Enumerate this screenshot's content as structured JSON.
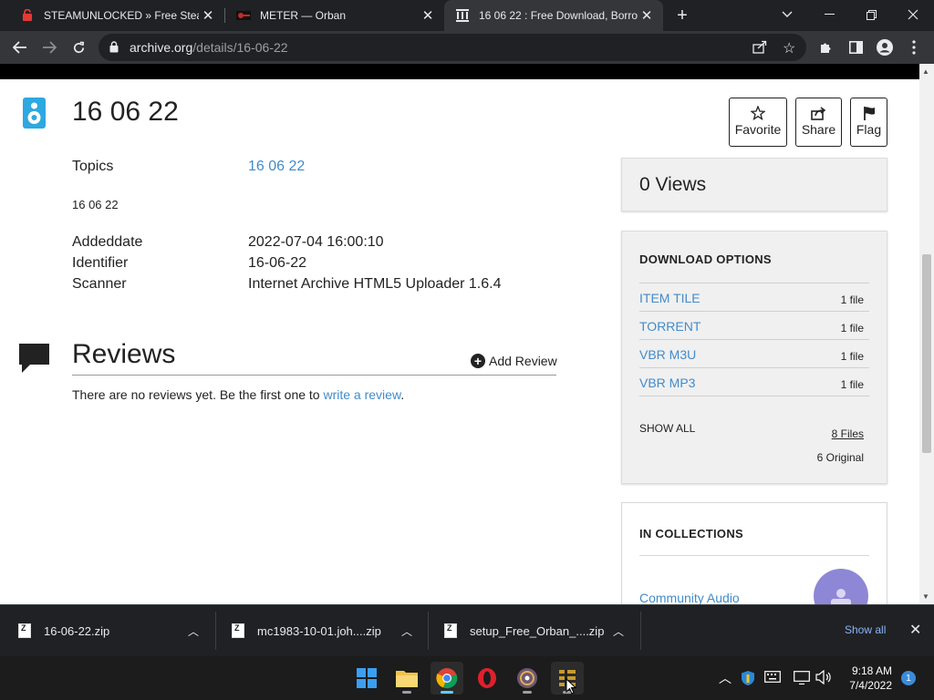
{
  "browser": {
    "tabs": [
      {
        "title": "STEAMUNLOCKED » Free Steam"
      },
      {
        "title": "METER — Orban"
      },
      {
        "title": "16 06 22 : Free Download, Borrow"
      }
    ],
    "url_domain": "archive.org",
    "url_path": "/details/16-06-22"
  },
  "item": {
    "title": "16 06 22",
    "actions": {
      "favorite": "Favorite",
      "share": "Share",
      "flag": "Flag"
    },
    "topics_label": "Topics",
    "topics_value": "16 06 22",
    "description": "16 06 22",
    "metadata": [
      {
        "label": "Addeddate",
        "value": "2022-07-04 16:00:10"
      },
      {
        "label": "Identifier",
        "value": "16-06-22"
      },
      {
        "label": "Scanner",
        "value": "Internet Archive HTML5 Uploader 1.6.4"
      }
    ]
  },
  "reviews": {
    "title": "Reviews",
    "add_label": "Add Review",
    "empty_text": "There are no reviews yet. Be the first one to ",
    "empty_link": "write a review",
    "empty_end": "."
  },
  "sidebar": {
    "views": "0 Views",
    "download": {
      "heading": "DOWNLOAD OPTIONS",
      "options": [
        {
          "name": "ITEM TILE",
          "count": "1 file"
        },
        {
          "name": "TORRENT",
          "count": "1 file"
        },
        {
          "name": "VBR M3U",
          "count": "1 file"
        },
        {
          "name": "VBR MP3",
          "count": "1 file"
        }
      ],
      "show_all": "SHOW ALL",
      "files_link": "8 Files",
      "original_count": "6 Original"
    },
    "collections": {
      "heading": "IN COLLECTIONS",
      "items": [
        {
          "name": "Community Audio"
        }
      ]
    }
  },
  "downloads_shelf": {
    "items": [
      {
        "name": "16-06-22.zip"
      },
      {
        "name": "mc1983-10-01.joh....zip"
      },
      {
        "name": "setup_Free_Orban_....zip"
      }
    ],
    "show_all": "Show all"
  },
  "taskbar": {
    "time": "9:18 AM",
    "date": "7/4/2022",
    "notification_count": "1"
  },
  "colors": {
    "link": "#428bca",
    "chrome_dark": "#202124",
    "chrome_toolbar": "#35363a",
    "item_icon": "#2ea8e0"
  }
}
